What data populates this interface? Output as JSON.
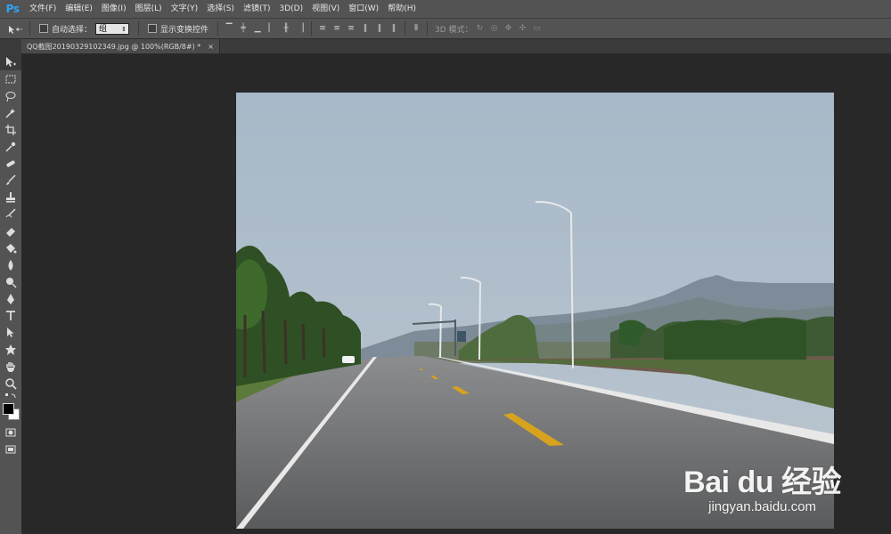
{
  "app": {
    "logo": "Ps"
  },
  "menu": [
    "文件(F)",
    "编辑(E)",
    "图像(I)",
    "图层(L)",
    "文字(Y)",
    "选择(S)",
    "滤镜(T)",
    "3D(D)",
    "视图(V)",
    "窗口(W)",
    "帮助(H)"
  ],
  "options": {
    "auto_select_label": "自动选择：",
    "auto_select_value": "组",
    "transform_label": "显示变换控件",
    "mode_3d_label": "3D 模式："
  },
  "document": {
    "tab_title": "QQ截图20190329102349.jpg @ 100%(RGB/8#) *",
    "close": "×"
  },
  "watermark": {
    "main": "Bai du 经验",
    "sub": "jingyan.baidu.com"
  },
  "colors": {
    "accent": "#2fa3f5",
    "ui_bg": "#535353",
    "canvas_bg": "#282828"
  }
}
